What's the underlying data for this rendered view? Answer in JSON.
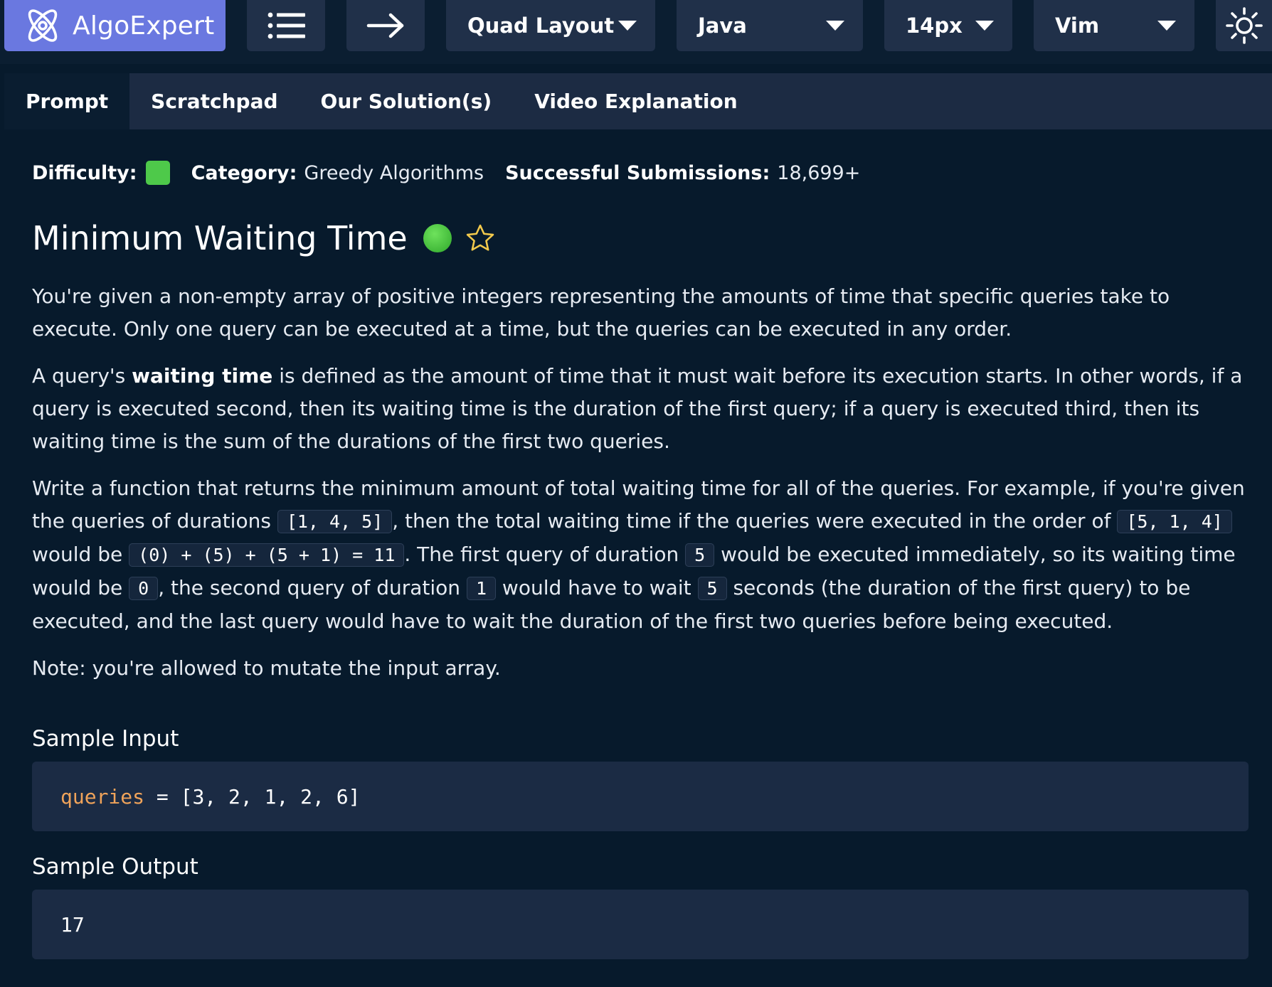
{
  "toolbar": {
    "brand": "AlgoExpert",
    "layout_label": "Quad Layout",
    "language_label": "Java",
    "font_size_label": "14px",
    "keymap_label": "Vim",
    "brand_color": "#6a78e0"
  },
  "tabs": [
    {
      "label": "Prompt",
      "active": true
    },
    {
      "label": "Scratchpad",
      "active": false
    },
    {
      "label": "Our Solution(s)",
      "active": false
    },
    {
      "label": "Video Explanation",
      "active": false
    }
  ],
  "meta": {
    "difficulty_label": "Difficulty:",
    "difficulty_color": "#4ec94a",
    "category_label": "Category:",
    "category_value": "Greedy Algorithms",
    "submissions_label": "Successful Submissions:",
    "submissions_value": "18,699+"
  },
  "problem": {
    "title": "Minimum Waiting Time",
    "p1": "You're given a non-empty array of positive integers representing the amounts of time that specific queries take to execute. Only one query can be executed at a time, but the queries can be executed in any order.",
    "p2_pre": "A query's ",
    "p2_bold": "waiting time",
    "p2_post": " is defined as the amount of time that it must wait before its execution starts. In other words, if a query is executed second, then its waiting time is the duration of the first query; if a query is executed third, then its waiting time is the sum of the durations of the first two queries.",
    "p3": {
      "t1": "Write a function that returns the minimum amount of total waiting time for all of the queries. For example, if you're given the queries of durations ",
      "c1": "[1, 4, 5]",
      "t2": ", then the total waiting time if the queries were executed in the order of ",
      "c2": "[5, 1, 4]",
      "t3": " would be ",
      "c3": "(0) + (5) + (5 + 1) = 11",
      "t4": ". The first query of duration ",
      "c4": "5",
      "t5": " would be executed immediately, so its waiting time would be ",
      "c5": "0",
      "t6": ", the second query of duration ",
      "c6": "1",
      "t7": " would have to wait ",
      "c7": "5",
      "t8": " seconds (the duration of the first query) to be executed, and the last query would have to wait the duration of the first two queries before being executed."
    },
    "note": "Note: you're allowed to mutate the input array."
  },
  "sample_input": {
    "heading": "Sample Input",
    "var_name": "queries",
    "rest": " = [3, 2, 1, 2, 6]"
  },
  "sample_output": {
    "heading": "Sample Output",
    "value": "17"
  }
}
